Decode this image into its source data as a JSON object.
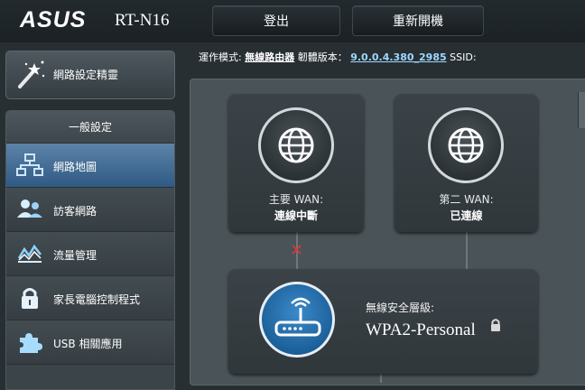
{
  "header": {
    "logo": "ASUS",
    "model": "RT-N16",
    "logout_label": "登出",
    "reboot_label": "重新開機"
  },
  "infobar": {
    "mode_label": "運作模式:",
    "mode_value": "無線路由器",
    "firmware_label": "韌體版本：",
    "firmware_value": "9.0.0.4.380_2985",
    "ssid_label": "SSID:"
  },
  "sidebar": {
    "wizard_label": "網路設定精靈",
    "section_title": "一般設定",
    "items": [
      {
        "label": "網路地圖",
        "icon": "network-map-icon",
        "active": true
      },
      {
        "label": "訪客網路",
        "icon": "guest-network-icon",
        "active": false
      },
      {
        "label": "流量管理",
        "icon": "traffic-manager-icon",
        "active": false
      },
      {
        "label": "家長電腦控制程式",
        "icon": "parental-control-lock-icon",
        "active": false
      },
      {
        "label": "USB 相關應用",
        "icon": "usb-puzzle-icon",
        "active": false
      }
    ]
  },
  "network_map": {
    "wan1_title": "主要 WAN:",
    "wan1_status": "連線中斷",
    "wan2_title": "第二 WAN:",
    "wan2_status": "已連線",
    "security_label": "無線安全層級:",
    "security_value": "WPA2-Personal"
  },
  "colors": {
    "active_item": "#3f6f9c",
    "disconnect_mark": "#d43a3a",
    "router_circle": "#1c66a8"
  }
}
